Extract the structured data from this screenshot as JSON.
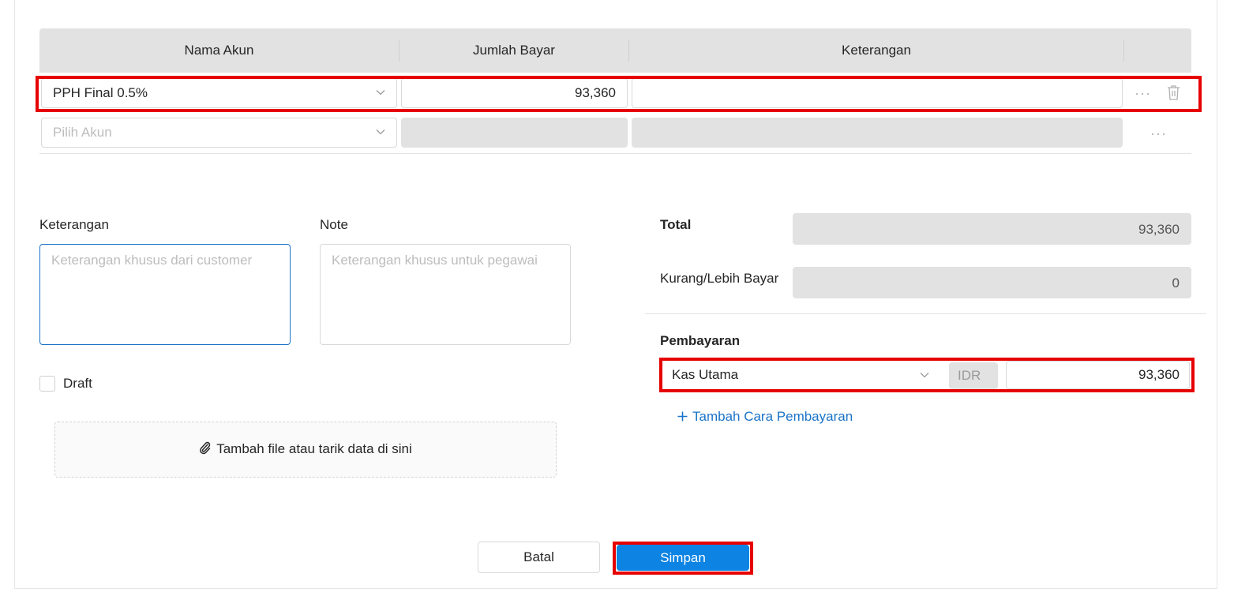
{
  "table": {
    "headers": [
      "Nama Akun",
      "Jumlah Bayar",
      "Keterangan"
    ],
    "rows": [
      {
        "account": "PPH Final 0.5%",
        "amount": "93,360",
        "note": ""
      },
      {
        "account_placeholder": "Pilih Akun"
      }
    ],
    "more_icon": "···"
  },
  "notes": {
    "keterangan_label": "Keterangan",
    "keterangan_placeholder": "Keterangan khusus dari customer",
    "note_label": "Note",
    "note_placeholder": "Keterangan khusus untuk pegawai",
    "draft_label": "Draft",
    "attach_label": "Tambah file atau tarik data di sini"
  },
  "summary": {
    "total_label": "Total",
    "total_value": "93,360",
    "diff_label": "Kurang/Lebih Bayar",
    "diff_value": "0"
  },
  "payment": {
    "title": "Pembayaran",
    "method": "Kas Utama",
    "currency": "IDR",
    "amount": "93,360",
    "add_label": "Tambah Cara Pembayaran"
  },
  "actions": {
    "cancel": "Batal",
    "save": "Simpan"
  },
  "colors": {
    "accent": "#0d83e3",
    "highlight": "#e60000"
  }
}
